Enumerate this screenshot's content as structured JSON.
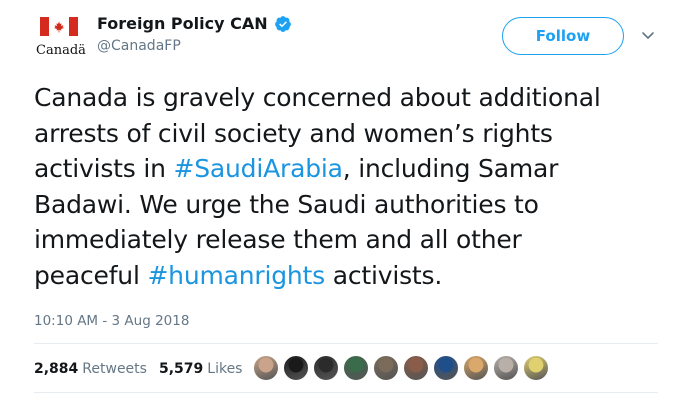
{
  "account": {
    "display_name": "Foreign Policy CAN",
    "handle": "@CanadaFP",
    "wordmark": "Canadä",
    "verified_icon": "verified-badge-icon",
    "logo_icon": "canada-flag-icon"
  },
  "follow_button": {
    "label": "Follow",
    "accent": "#1da1f2"
  },
  "menu": {
    "icon": "chevron-down-icon"
  },
  "tweet": {
    "lines": [
      [
        {
          "text": "Canada is gravely concerned about additional"
        }
      ],
      [
        {
          "text": "arrests of civil society and women’s rights"
        }
      ],
      [
        {
          "text": "activists in "
        },
        {
          "text": "#SaudiArabia",
          "hashtag": true
        },
        {
          "text": ", including Samar"
        }
      ],
      [
        {
          "text": "Badawi. We urge the Saudi authorities to"
        }
      ],
      [
        {
          "text": "immediately release them and all other"
        }
      ],
      [
        {
          "text": "peaceful "
        },
        {
          "text": "#humanrights",
          "hashtag": true
        },
        {
          "text": " activists."
        }
      ]
    ],
    "hashtag_color": "#1b95e0"
  },
  "timestamp": "10:10 AM - 3 Aug 2018",
  "stats": {
    "retweets_count": "2,884",
    "retweets_label": "Retweets",
    "likes_count": "5,579",
    "likes_label": "Likes"
  },
  "liker_avatars": [
    {
      "name": "avatar-1",
      "color": "#c9a48a"
    },
    {
      "name": "avatar-2",
      "color": "#1a1a1a"
    },
    {
      "name": "avatar-3",
      "color": "#2b2b2b"
    },
    {
      "name": "avatar-4",
      "color": "#3a6b4a"
    },
    {
      "name": "avatar-5",
      "color": "#7a6b5a"
    },
    {
      "name": "avatar-6",
      "color": "#8a5c4a"
    },
    {
      "name": "avatar-7",
      "color": "#1f4f8a"
    },
    {
      "name": "avatar-8",
      "color": "#d9a86a"
    },
    {
      "name": "avatar-9",
      "color": "#b8b0a8"
    },
    {
      "name": "avatar-10",
      "color": "#e0d070"
    }
  ]
}
